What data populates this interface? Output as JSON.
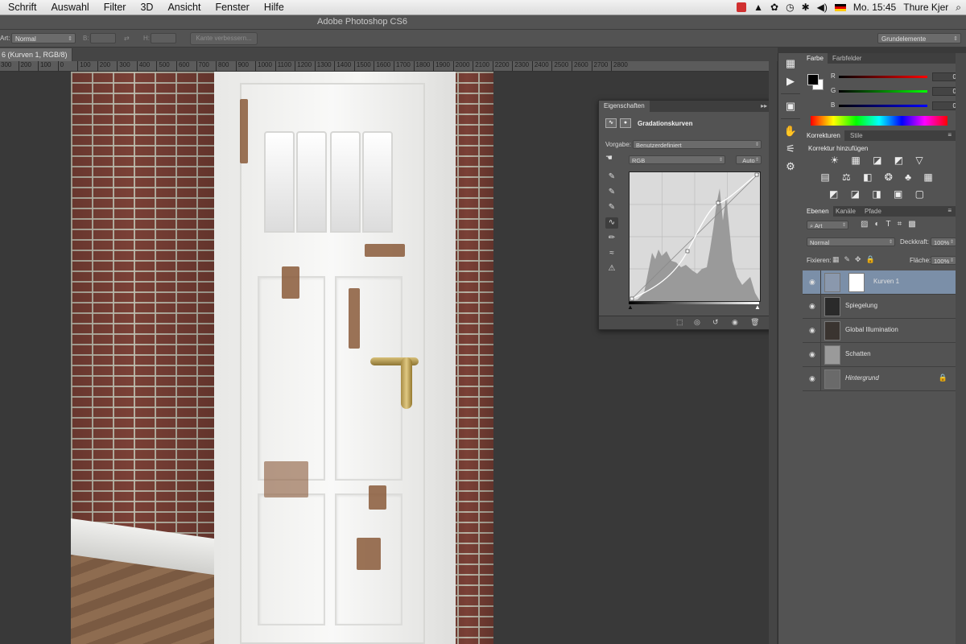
{
  "menubar": {
    "items": [
      "Schrift",
      "Auswahl",
      "Filter",
      "3D",
      "Ansicht",
      "Fenster",
      "Hilfe"
    ],
    "clock": "Mo. 15:45",
    "user": "Thure Kjer",
    "status_icons": [
      "record-icon",
      "adobe-icon",
      "sync-icon",
      "timemachine-icon",
      "bluetooth-icon",
      "volume-icon",
      "flag-icon"
    ]
  },
  "app": {
    "title": "Adobe Photoshop CS6"
  },
  "options": {
    "art_label": "Art:",
    "art_value": "Normal",
    "b_label": "B:",
    "h_label": "H:",
    "refine_button": "Kante verbessern...",
    "workspace": "Grundelemente"
  },
  "document": {
    "tab_title": "6 (Kurven 1, RGB/8) *",
    "ruler_ticks": [
      "300",
      "200",
      "100",
      "0",
      "100",
      "200",
      "300",
      "400",
      "500",
      "600",
      "700",
      "800",
      "900",
      "1000",
      "1100",
      "1200",
      "1300",
      "1400",
      "1500",
      "1600",
      "1700",
      "1800",
      "1900",
      "2000",
      "2100",
      "2200",
      "2300",
      "2400",
      "2500",
      "2600",
      "2700",
      "2800"
    ]
  },
  "properties": {
    "tab": "Eigenschaften",
    "title": "Gradationskurven",
    "preset_label": "Vorgabe:",
    "preset_value": "Benutzerdefiniert",
    "channel_value": "RGB",
    "auto_button": "Auto"
  },
  "color_panel": {
    "tabs": [
      "Farbe",
      "Farbfelder"
    ],
    "r_label": "R",
    "g_label": "G",
    "b_label": "B",
    "r_value": "0",
    "g_value": "0",
    "b_value": "0"
  },
  "corrections": {
    "tabs": [
      "Korrekturen",
      "Stile"
    ],
    "heading": "Korrektur hinzufügen",
    "row1": "☀ ▦ ◪ ◩ ▽",
    "row2": "▤ ⚖ ◧ ❂ ♣ ▦",
    "row3": "◩ ◪ ◨ ▣ ▢"
  },
  "layers": {
    "tabs": [
      "Ebenen",
      "Kanäle",
      "Pfade"
    ],
    "filter_value": "Art",
    "blend_mode": "Normal",
    "opacity_label": "Deckkraft:",
    "opacity_value": "100%",
    "lock_label": "Fixieren:",
    "fill_label": "Fläche:",
    "fill_value": "100%",
    "items": [
      {
        "name": "Kurven 1",
        "selected": true
      },
      {
        "name": "Spiegelung",
        "selected": false
      },
      {
        "name": "Global Illumination",
        "selected": false
      },
      {
        "name": "Schatten",
        "selected": false
      },
      {
        "name": "Hintergrund",
        "selected": false
      }
    ]
  },
  "colors": {
    "selection": "#7b8fa8",
    "panel": "#535353",
    "menubar": "#e8e8e8"
  }
}
